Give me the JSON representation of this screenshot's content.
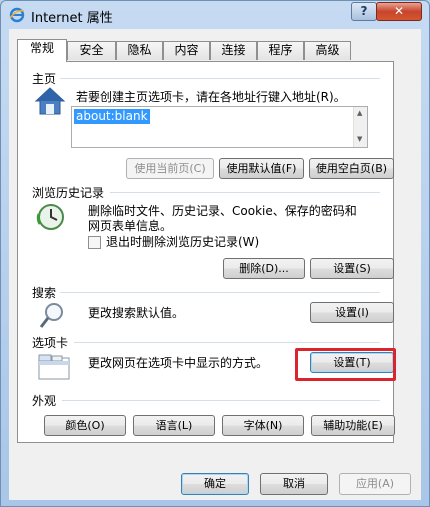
{
  "window": {
    "title": "Internet 属性",
    "help_label": "?",
    "close_label": "✕"
  },
  "tabs": [
    "常规",
    "安全",
    "隐私",
    "内容",
    "连接",
    "程序",
    "高级"
  ],
  "homepage": {
    "label": "主页",
    "description": "若要创建主页选项卡，请在各地址行键入地址(R)。",
    "value": "about:blank",
    "buttons": {
      "use_current": "使用当前页(C)",
      "use_default": "使用默认值(F)",
      "use_blank": "使用空白页(B)"
    }
  },
  "history": {
    "label": "浏览历史记录",
    "description": "删除临时文件、历史记录、Cookie、保存的密码和网页表单信息。",
    "checkbox_label": "退出时删除浏览历史记录(W)",
    "checkbox_checked": false,
    "buttons": {
      "delete": "删除(D)...",
      "settings": "设置(S)"
    }
  },
  "search": {
    "label": "搜索",
    "description": "更改搜索默认值。",
    "buttons": {
      "settings": "设置(I)"
    }
  },
  "tabs_section": {
    "label": "选项卡",
    "description": "更改网页在选项卡中显示的方式。",
    "buttons": {
      "settings": "设置(T)"
    }
  },
  "appearance": {
    "label": "外观",
    "buttons": {
      "colors": "颜色(O)",
      "languages": "语言(L)",
      "fonts": "字体(N)",
      "accessibility": "辅助功能(E)"
    }
  },
  "footer": {
    "ok": "确定",
    "cancel": "取消",
    "apply": "应用(A)"
  },
  "colors": {
    "highlight": "#d9252b",
    "selection": "#3399ff"
  }
}
